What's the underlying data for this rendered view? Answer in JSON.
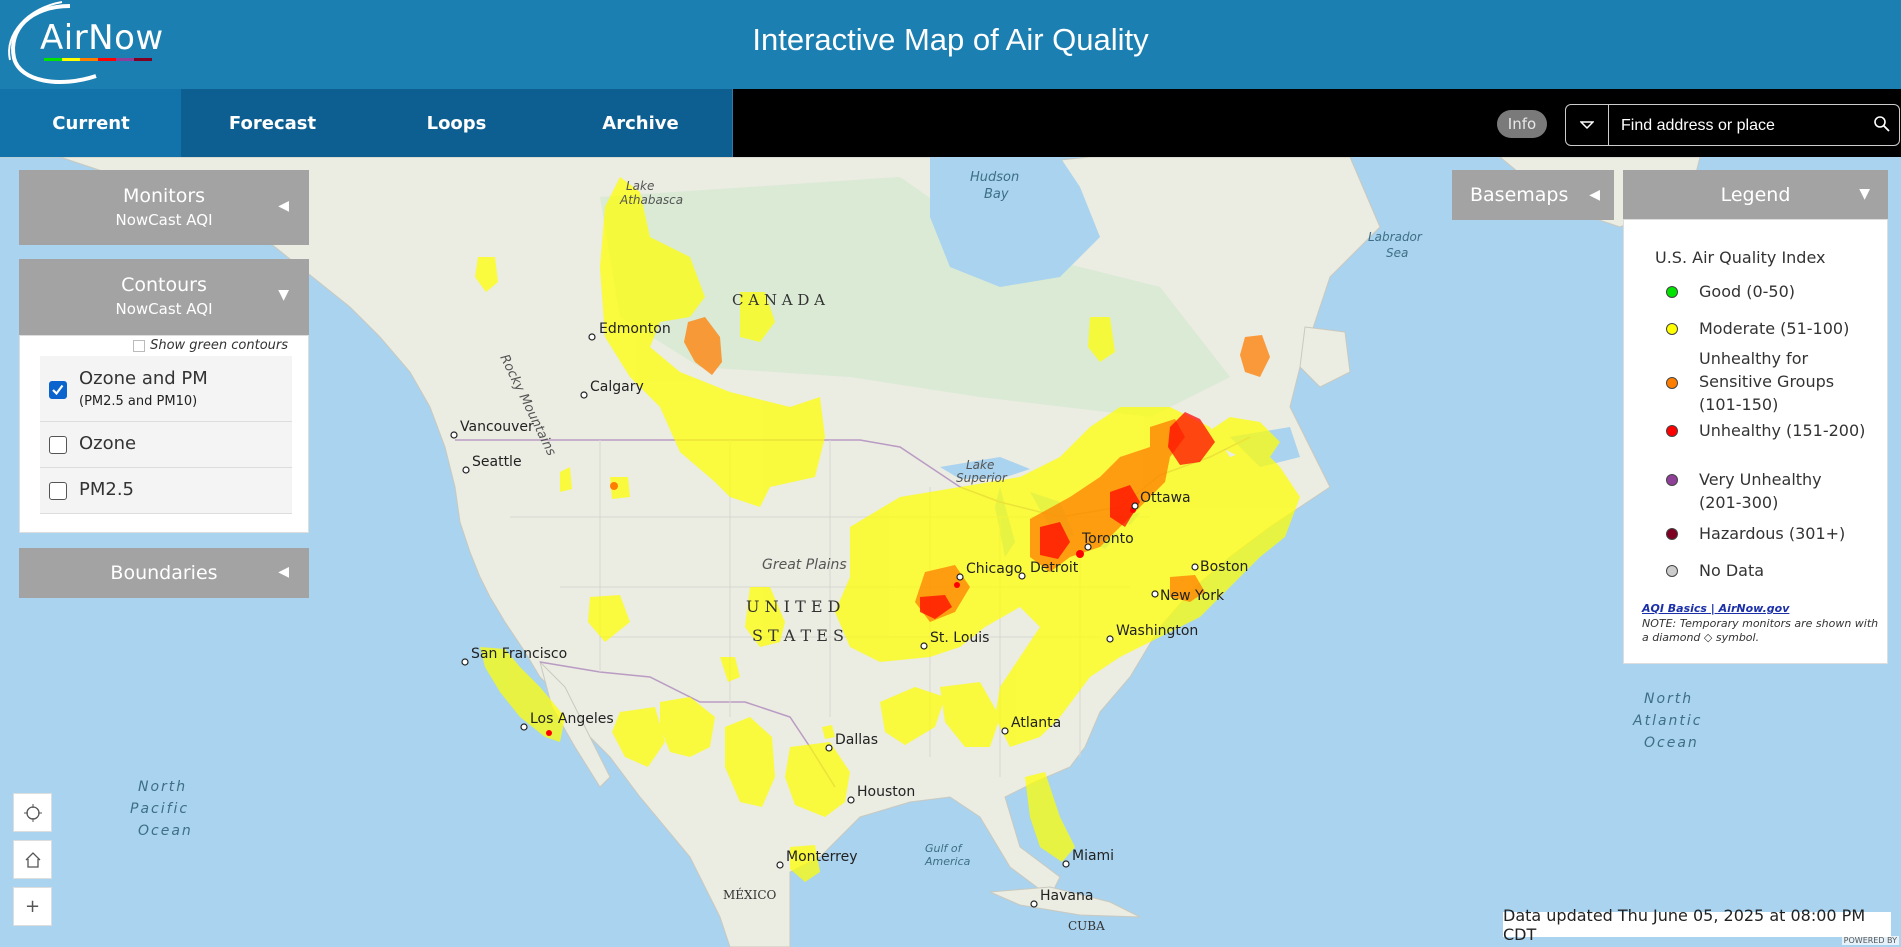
{
  "header": {
    "logo_text": "AirNow",
    "title": "Interactive Map of Air Quality"
  },
  "nav": {
    "tabs": [
      {
        "label": "Current",
        "active": true
      },
      {
        "label": "Forecast",
        "active": false
      },
      {
        "label": "Loops",
        "active": false
      },
      {
        "label": "Archive",
        "active": false
      }
    ],
    "info_label": "Info",
    "search_placeholder": "Find address or place"
  },
  "panels": {
    "monitors": {
      "title": "Monitors",
      "subtitle": "NowCast AQI",
      "expanded": false
    },
    "contours": {
      "title": "Contours",
      "subtitle": "NowCast AQI",
      "expanded": true,
      "green_toggle_label": "Show green contours",
      "options": [
        {
          "label": "Ozone and PM",
          "sublabel": "(PM2.5 and PM10)",
          "checked": true
        },
        {
          "label": "Ozone",
          "sublabel": "",
          "checked": false
        },
        {
          "label": "PM2.5",
          "sublabel": "",
          "checked": false
        }
      ]
    },
    "boundaries": {
      "title": "Boundaries",
      "expanded": false
    },
    "basemaps": {
      "title": "Basemaps",
      "expanded": false
    }
  },
  "legend": {
    "title": "Legend",
    "index_title": "U.S. Air Quality Index",
    "items": [
      {
        "label": "Good (0-50)",
        "color": "#00e400"
      },
      {
        "label": "Moderate (51-100)",
        "color": "#ffff00"
      },
      {
        "label": "Unhealthy for Sensitive Groups (101-150)",
        "color": "#ff7e00"
      },
      {
        "label": "Unhealthy (151-200)",
        "color": "#ff0000"
      },
      {
        "label": "Very Unhealthy (201-300)",
        "color": "#8f3f97"
      },
      {
        "label": "Hazardous (301+)",
        "color": "#7e0023"
      },
      {
        "label": "No Data",
        "color": "#cccccc"
      }
    ],
    "link_text": "AQI Basics | AirNow.gov",
    "note": "NOTE: Temporary monitors are shown with a diamond ◇ symbol."
  },
  "map": {
    "regions": {
      "canada": "C A N A D A",
      "united": "U N I T E D",
      "states": "S T A T E S",
      "mexico": "MÉXICO",
      "cuba": "CUBA",
      "great_plains": "Great Plains",
      "rocky_mountains": "Rocky Mountains",
      "hudson_bay_1": "Hudson",
      "hudson_bay_2": "Bay",
      "labrador_sea_1": "Labrador",
      "labrador_sea_2": "Sea",
      "lake_athabasca_1": "Lake",
      "lake_athabasca_2": "Athabasca",
      "lake_superior_1": "Lake",
      "lake_superior_2": "Superior",
      "gulf_1": "Gulf of",
      "gulf_2": "America",
      "north_pacific_1": "North",
      "north_pacific_2": "Pacific",
      "north_pacific_3": "Ocean",
      "north_atlantic_1": "North",
      "north_atlantic_2": "Atlantic",
      "north_atlantic_3": "Ocean"
    },
    "cities": {
      "edmonton": "Edmonton",
      "calgary": "Calgary",
      "vancouver": "Vancouver",
      "seattle": "Seattle",
      "san_francisco": "San Francisco",
      "los_angeles": "Los Angeles",
      "dallas": "Dallas",
      "houston": "Houston",
      "monterrey": "Monterrey",
      "st_louis": "St. Louis",
      "chicago": "Chicago",
      "detroit": "Detroit",
      "toronto": "Toronto",
      "ottawa": "Ottawa",
      "boston": "Boston",
      "new_york": "New York",
      "washington": "Washington",
      "atlanta": "Atlanta",
      "miami": "Miami",
      "havana": "Havana"
    },
    "zoom_in_label": "+"
  },
  "status": {
    "text": "Data updated Thu June 05, 2025 at 08:00 PM CDT",
    "powered": "POWERED BY"
  }
}
